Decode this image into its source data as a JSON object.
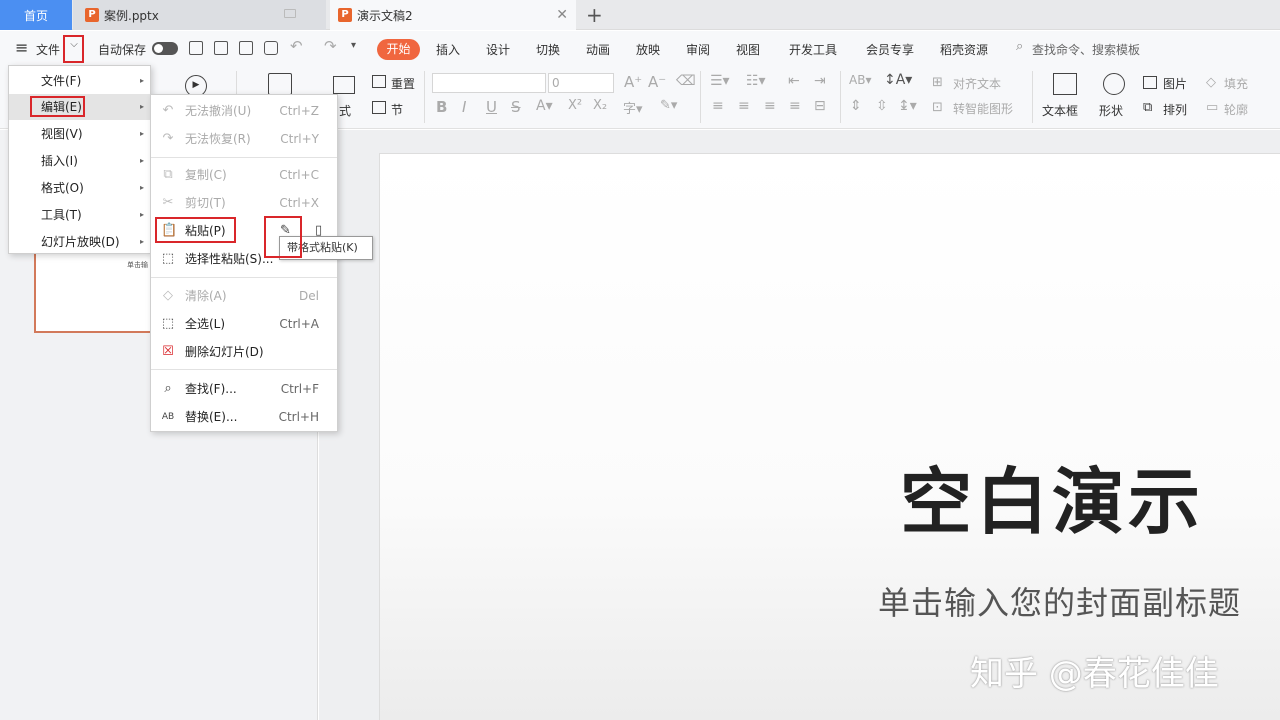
{
  "tabs": {
    "home": "首页",
    "case_file": "案例.pptx",
    "current_doc": "演示文稿2",
    "add": "+",
    "close": "✕"
  },
  "menu_row": {
    "hamburger": "≡",
    "file": "文件",
    "autosave": "自动保存",
    "tabs": [
      "开始",
      "插入",
      "设计",
      "切换",
      "动画",
      "放映",
      "审阅",
      "视图",
      "开发工具",
      "会员专享",
      "稻壳资源"
    ],
    "search": "查找命令、搜索模板"
  },
  "ribbon": {
    "reset": "重置",
    "style_partial": "式",
    "section": "节",
    "font_size": "0",
    "align_text": "对齐文本",
    "smart_shape": "转智能图形",
    "textbox": "文本框",
    "shape": "形状",
    "picture": "图片",
    "arrange": "排列",
    "fill": "填充",
    "outline": "轮廓",
    "format_buttons": [
      "B",
      "I",
      "U",
      "S"
    ]
  },
  "main_menu": {
    "items": [
      {
        "label": "文件(F)"
      },
      {
        "label": "编辑(E)"
      },
      {
        "label": "视图(V)"
      },
      {
        "label": "插入(I)"
      },
      {
        "label": "格式(O)"
      },
      {
        "label": "工具(T)"
      },
      {
        "label": "幻灯片放映(D)"
      }
    ]
  },
  "edit_menu": {
    "undo": {
      "label": "无法撤消(U)",
      "shortcut": "Ctrl+Z"
    },
    "redo": {
      "label": "无法恢复(R)",
      "shortcut": "Ctrl+Y"
    },
    "copy": {
      "label": "复制(C)",
      "shortcut": "Ctrl+C"
    },
    "cut": {
      "label": "剪切(T)",
      "shortcut": "Ctrl+X"
    },
    "paste": {
      "label": "粘贴(P)"
    },
    "paste_special": {
      "label": "选择性粘贴(S)..."
    },
    "clear": {
      "label": "清除(A)",
      "shortcut": "Del"
    },
    "select_all": {
      "label": "全选(L)",
      "shortcut": "Ctrl+A"
    },
    "delete_slide": {
      "label": "删除幻灯片(D)"
    },
    "find": {
      "label": "查找(F)...",
      "shortcut": "Ctrl+F"
    },
    "replace": {
      "label": "替换(E)...",
      "shortcut": "Ctrl+H"
    }
  },
  "tooltip": "带格式粘贴(K)",
  "thumbnail_text": "单击输",
  "slide": {
    "title": "空白演示",
    "subtitle": "单击输入您的封面副标题",
    "watermark": "知乎 @春花佳佳"
  },
  "colors": {
    "home_tab": "#4b8ff2",
    "start_tab": "#f0663f",
    "highlight_box": "#d9262a",
    "ppt_icon": "#e8652d"
  }
}
